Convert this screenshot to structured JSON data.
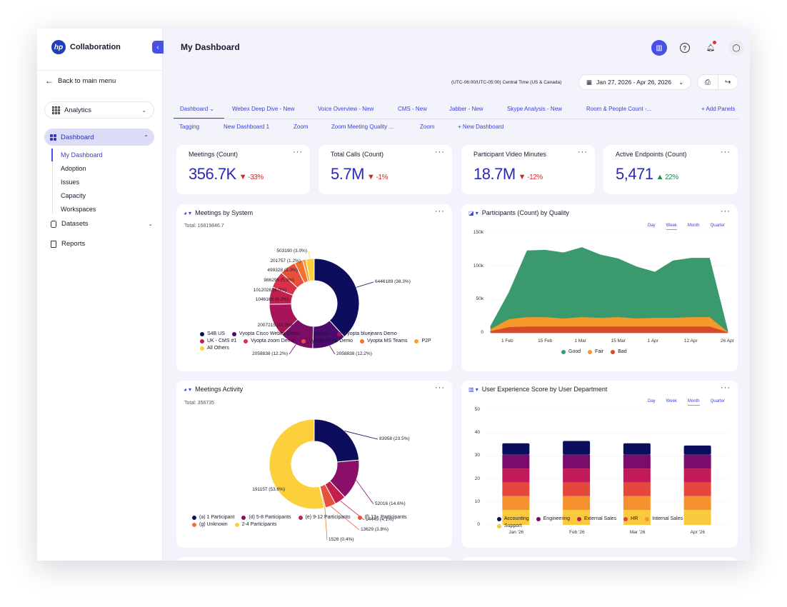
{
  "brand": {
    "name": "Collaboration",
    "logo_text": "hp"
  },
  "sidebar": {
    "back_label": "Back to main menu",
    "analytics_label": "Analytics",
    "dashboard_label": "Dashboard",
    "sub_items": [
      "My Dashboard",
      "Adoption",
      "Issues",
      "Capacity",
      "Workspaces"
    ],
    "datasets_label": "Datasets",
    "reports_label": "Reports"
  },
  "header": {
    "title": "My Dashboard",
    "timezone": "(UTC-06:00/UTC-05:00) Central Time (US & Canada)",
    "date_range": "Jan 27, 2026 - Apr 26, 2026"
  },
  "tabs_row1": [
    "Dashboard",
    "Webex Deep Dive - New",
    "Voice Overview - New",
    "CMS - New",
    "Jabber - New",
    "Skype Analysis - New",
    "Room & People Count -...",
    "+ Add Panels"
  ],
  "tabs_row2": [
    "Tagging",
    "New Dashboard 1",
    "Zoom",
    "Zoom Meeting Quality ...",
    "Zoom",
    "+ New Dashboard"
  ],
  "kpis": [
    {
      "title": "Meetings (Count)",
      "value": "356.7K",
      "delta": "-33%",
      "trend": "down"
    },
    {
      "title": "Total Calls (Count)",
      "value": "5.7M",
      "delta": "-1%",
      "trend": "down"
    },
    {
      "title": "Participant Video Minutes",
      "value": "18.7M",
      "delta": "-12%",
      "trend": "down"
    },
    {
      "title": "Active Endpoints (Count)",
      "value": "5,471",
      "delta": "22%",
      "trend": "up"
    }
  ],
  "colors": {
    "accent": "#4a50e6",
    "good": "#3a9a6e",
    "fair": "#f59a2a",
    "bad": "#d8482a"
  },
  "panels": {
    "meetings_by_system": {
      "title": "Meetings by System",
      "total": "Total: 16819846.7"
    },
    "participants_quality": {
      "title": "Participants (Count) by Quality",
      "granularity": [
        "Day",
        "Week",
        "Month",
        "Quarter"
      ],
      "selected": "Week"
    },
    "meetings_activity": {
      "title": "Meetings Activity",
      "total": "Total: 356735"
    },
    "ux_score": {
      "title": "User Experience Score by User Department",
      "granularity": [
        "Day",
        "Week",
        "Month",
        "Quarter"
      ],
      "selected": "Month"
    }
  },
  "chart_data": [
    {
      "type": "pie",
      "title": "Meetings by System",
      "slices": [
        {
          "name": "S4B US",
          "value": 6446189,
          "label": "6446189 (38.3%)",
          "color": "#0d0d5e"
        },
        {
          "name": "Vyopta Cisco Webex Demo",
          "value": 2058838,
          "label": "2058838 (12.2%)",
          "color": "#4a0a6e"
        },
        {
          "name": "Webex",
          "value": 2058838,
          "label": "2058838 (12.2%)",
          "color": "#7a0e66"
        },
        {
          "name": "Vyopta bluejeans Demo",
          "value": 2007215,
          "label": "2007215 (11.9%)",
          "color": "#a81458"
        },
        {
          "name": "UK - CMS #1",
          "value": 1046168,
          "label": "1046168 (6.2%)",
          "color": "#c41e4e"
        },
        {
          "name": "Vyopta zoom Demo",
          "value": 1012028,
          "label": "1012028 (6.0%)",
          "color": "#d8324a"
        },
        {
          "name": "Vyopta Pexip Demo",
          "value": 986295,
          "label": "986295 (5.9%)",
          "color": "#e9503c"
        },
        {
          "name": "Vyopta MS Teams",
          "value": 499328,
          "label": "499328 (3.0%)",
          "color": "#f2722e"
        },
        {
          "name": "P2P",
          "value": 201757,
          "label": "201757 (1.2%)",
          "color": "#f7a234"
        },
        {
          "name": "All Others",
          "value": 503190,
          "label": "503190 (3.0%)",
          "color": "#fbd03a"
        }
      ]
    },
    {
      "type": "area",
      "title": "Participants (Count) by Quality",
      "x": [
        "Jan 27",
        "Feb 3",
        "Feb 10",
        "Feb 17",
        "Feb 24",
        "Mar 3",
        "Mar 10",
        "Mar 17",
        "Mar 24",
        "Mar 31",
        "Apr 7",
        "Apr 14",
        "Apr 21",
        "Apr 26"
      ],
      "x_ticks": [
        "1 Feb",
        "15 Feb",
        "1 Mar",
        "15 Mar",
        "1 Apr",
        "12 Apr",
        "26 Apr"
      ],
      "ylim": [
        0,
        150000
      ],
      "y_ticks": [
        "0",
        "50k",
        "100k",
        "150k"
      ],
      "series": [
        {
          "name": "Bad",
          "color": "#d8482a",
          "values": [
            2000,
            8000,
            9000,
            9000,
            9000,
            9000,
            9000,
            9000,
            9000,
            9000,
            9000,
            9000,
            9000,
            500
          ]
        },
        {
          "name": "Fair",
          "color": "#f59a2a",
          "values": [
            3000,
            12000,
            14000,
            14000,
            12000,
            14000,
            13000,
            14000,
            12000,
            13000,
            13000,
            14000,
            14000,
            500
          ]
        },
        {
          "name": "Good",
          "color": "#3a9a6e",
          "values": [
            5000,
            40000,
            100000,
            101000,
            99000,
            105000,
            95000,
            88000,
            78000,
            69000,
            86000,
            89000,
            89000,
            2000
          ]
        }
      ]
    },
    {
      "type": "pie",
      "title": "Meetings Activity",
      "slices": [
        {
          "name": "(a) 1 Participant",
          "value": 83958,
          "label": "83958 (23.5%)",
          "color": "#0d0d5e"
        },
        {
          "name": "(d) 5-8 Participants",
          "value": 52016,
          "label": "52016 (14.6%)",
          "color": "#8a0f68"
        },
        {
          "name": "(e) 9-12 Participants",
          "value": 14449,
          "label": "14449 (4.1%)",
          "color": "#c41e4e"
        },
        {
          "name": "(f) 13+ Participants",
          "value": 13629,
          "label": "13629 (3.8%)",
          "color": "#e9503c"
        },
        {
          "name": "(g) Unknown",
          "value": 1526,
          "label": "1526 (0.4%)",
          "color": "#f2722e"
        },
        {
          "name": "2-4 Participants",
          "value": 191157,
          "label": "191157 (53.6%)",
          "color": "#fbd03a"
        }
      ]
    },
    {
      "type": "bar",
      "title": "User Experience Score by User Department",
      "categories": [
        "Jan '26",
        "Feb '26",
        "Mar '26",
        "Apr '26"
      ],
      "ylim": [
        0,
        50
      ],
      "y_ticks": [
        "0",
        "10",
        "20",
        "30",
        "40",
        "50"
      ],
      "series": [
        {
          "name": "Support",
          "color": "#fbc93d",
          "values": [
            6.5,
            6.5,
            6.5,
            6.5
          ]
        },
        {
          "name": "Internal Sales",
          "color": "#f6922e",
          "values": [
            6,
            6,
            6,
            6
          ]
        },
        {
          "name": "HR",
          "color": "#e5473c",
          "values": [
            6,
            6,
            6,
            6
          ]
        },
        {
          "name": "External Sales",
          "color": "#c21a58",
          "values": [
            6,
            6,
            6,
            6
          ]
        },
        {
          "name": "Engineering",
          "color": "#7b0c6c",
          "values": [
            6,
            6,
            6,
            6
          ]
        },
        {
          "name": "Accounting",
          "color": "#0d0d5e",
          "values": [
            5,
            6,
            5,
            4
          ]
        }
      ],
      "legend_order": [
        "Accounting",
        "Engineering",
        "External Sales",
        "HR",
        "Internal Sales",
        "Support"
      ]
    }
  ]
}
